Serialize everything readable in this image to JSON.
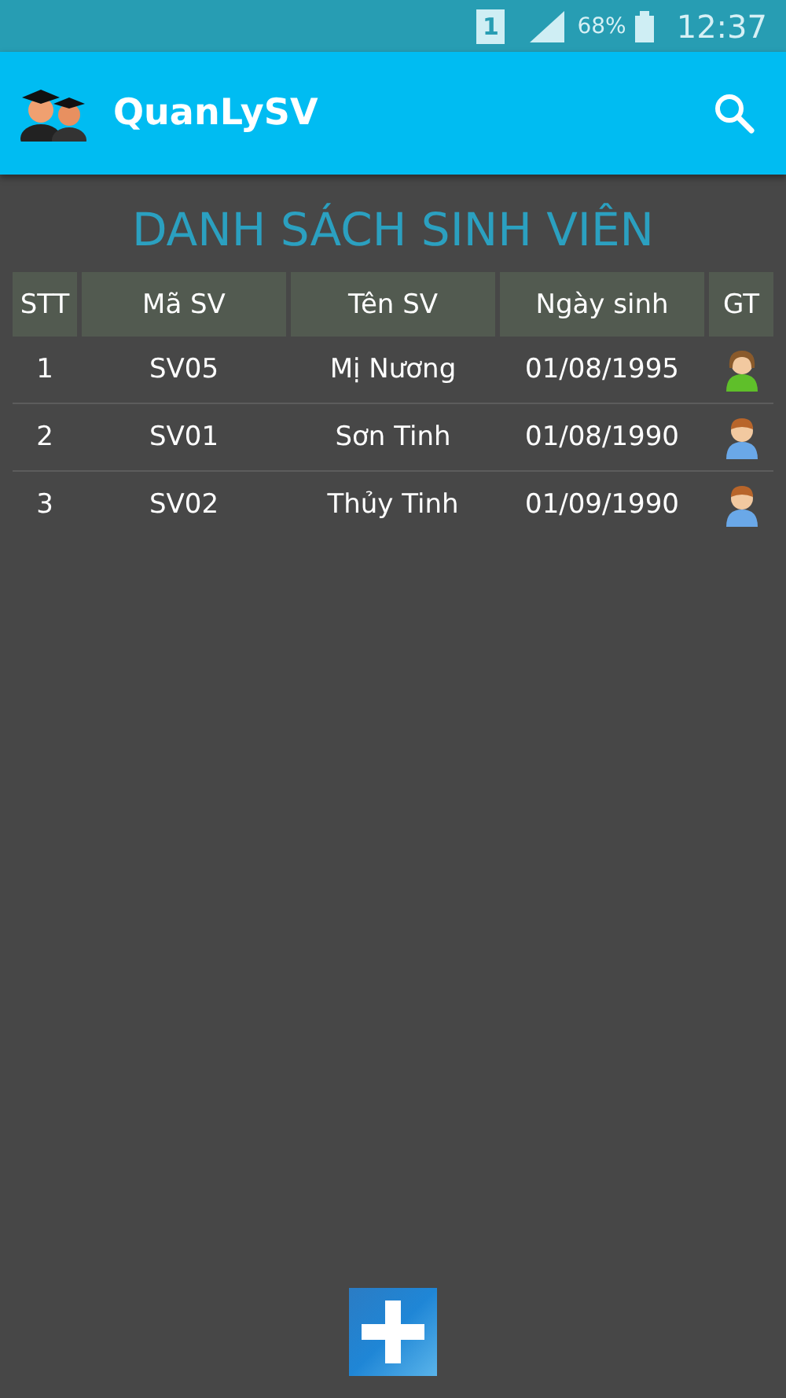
{
  "status_bar": {
    "sim": "1",
    "battery": "68%",
    "time": "12:37"
  },
  "app_bar": {
    "title": "QuanLySV"
  },
  "heading": "DANH SÁCH SINH VIÊN",
  "table": {
    "columns": [
      "STT",
      "Mã SV",
      "Tên SV",
      "Ngày sinh",
      "GT"
    ],
    "rows": [
      {
        "stt": "1",
        "id": "SV05",
        "name": "Mị Nương",
        "dob": "01/08/1995",
        "kind": "female"
      },
      {
        "stt": "2",
        "id": "SV01",
        "name": "Sơn Tinh",
        "dob": "01/08/1990",
        "kind": "male"
      },
      {
        "stt": "3",
        "id": "SV02",
        "name": "Thủy Tinh",
        "dob": "01/09/1990",
        "kind": "male"
      }
    ]
  }
}
